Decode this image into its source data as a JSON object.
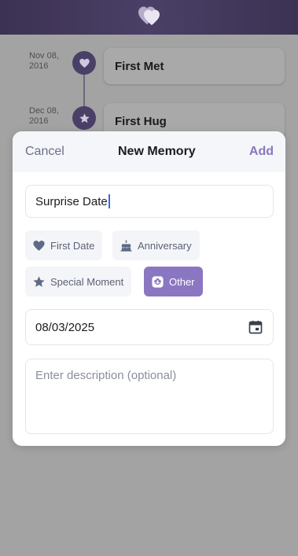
{
  "colors": {
    "accent": "#8b76c2",
    "header_bg": "#3c3253",
    "overlay": "#9a9a9a"
  },
  "header": {
    "icon": "heart-logo-icon"
  },
  "timeline": [
    {
      "date": "Nov 08, 2016",
      "title": "First Met",
      "icon": "heart-icon"
    },
    {
      "date": "Dec 08, 2016",
      "title": "First Hug",
      "icon": "star-icon"
    }
  ],
  "modal": {
    "cancel_label": "Cancel",
    "title": "New Memory",
    "add_label": "Add",
    "title_value": "Surprise Date",
    "categories": [
      {
        "label": "First Date",
        "icon": "heart-icon",
        "selected": false
      },
      {
        "label": "Anniversary",
        "icon": "cake-icon",
        "selected": false
      },
      {
        "label": "Special Moment",
        "icon": "star-icon",
        "selected": false
      },
      {
        "label": "Other",
        "icon": "flower-icon",
        "selected": true
      }
    ],
    "date_value": "08/03/2025",
    "date_icon": "calendar-icon",
    "description_placeholder": "Enter description (optional)"
  }
}
